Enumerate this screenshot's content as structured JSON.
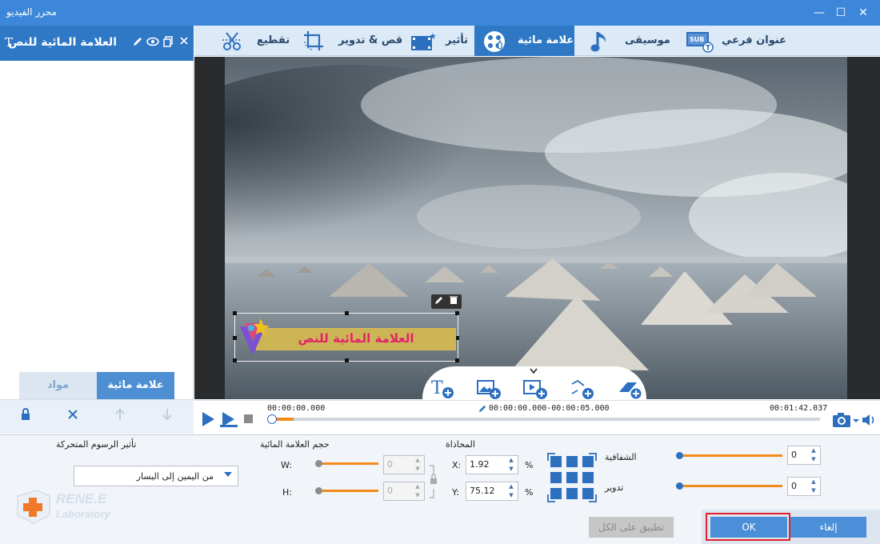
{
  "window": {
    "title": "محرر الفيديو",
    "minimize": "—",
    "maximize": "☐",
    "close": "✕"
  },
  "left_panel": {
    "header_title": "العلامة المائية للنص",
    "header_type_icon": "T",
    "tabs": {
      "watermark": "علامة مائية",
      "material": "مواد"
    }
  },
  "tabs": [
    {
      "label": "عنوان فرعي",
      "icon": "subtitle-icon"
    },
    {
      "label": "موسيقى",
      "icon": "music-icon"
    },
    {
      "label": "علامة مائية",
      "icon": "watermark-icon",
      "active": true
    },
    {
      "label": "تأثير",
      "icon": "effect-icon"
    },
    {
      "label": "قص & تدوير",
      "icon": "crop-rotate-icon"
    },
    {
      "label": "تقطيع",
      "icon": "cut-icon"
    }
  ],
  "preview": {
    "watermark_text": "العلامة المائية للنص"
  },
  "playback": {
    "time_start": "00:00:00.000",
    "time_range": "00:00:00.000-00:00:05.000",
    "time_end": "00:01:42.037",
    "progress_fraction": 0.04
  },
  "settings": {
    "animation_label": "تأثير الرسوم المتحركة",
    "animation_value": "من اليمين إلى اليسار",
    "size_label": "حجم العلامة المائية",
    "w_label": "W:",
    "h_label": "H:",
    "w_value": "0",
    "h_value": "0",
    "position_label": "المحاذاة",
    "x_label": "X:",
    "y_label": "Y:",
    "x_value": "1.92",
    "y_value": "75.12",
    "percent": "%",
    "opacity_label": "الشفافية",
    "opacity_value": "0",
    "rotation_label": "تدوير",
    "rotation_value": "0"
  },
  "buttons": {
    "apply_all": "تطبيق على الكل",
    "ok": "OK",
    "cancel": "إلغاء"
  },
  "logo": {
    "line1": "RENE.E",
    "line2": "Laboratory"
  },
  "colors": {
    "accent": "#2f78c5",
    "slider": "#f28a1c",
    "watermark_text": "#e2236b",
    "highlight": "#e3202a"
  }
}
